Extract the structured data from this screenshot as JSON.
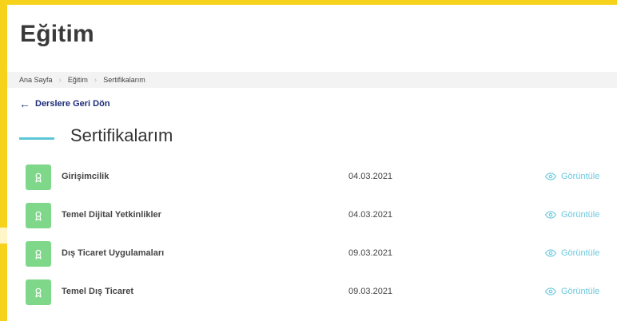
{
  "page": {
    "title": "Eğitim",
    "accent_color": "#f7d21a",
    "link_color": "#1d2c7a",
    "badge_color": "#7fd88a",
    "view_color": "#6cc9de"
  },
  "breadcrumb": {
    "items": [
      "Ana Sayfa",
      "Eğitim",
      "Sertifikalarım"
    ],
    "separator_icon": "chevron-right-icon"
  },
  "back_link": {
    "label": "Derslere Geri Dön",
    "icon": "arrow-left-icon"
  },
  "section": {
    "title": "Sertifikalarım"
  },
  "certificates": [
    {
      "name": "Girişimcilik",
      "date": "04.03.2021",
      "action": "Görüntüle",
      "icon": "award-icon"
    },
    {
      "name": "Temel Dijital Yetkinlikler",
      "date": "04.03.2021",
      "action": "Görüntüle",
      "icon": "award-icon"
    },
    {
      "name": "Dış Ticaret Uygulamaları",
      "date": "09.03.2021",
      "action": "Görüntüle",
      "icon": "award-icon"
    },
    {
      "name": "Temel Dış Ticaret",
      "date": "09.03.2021",
      "action": "Görüntüle",
      "icon": "award-icon"
    }
  ]
}
